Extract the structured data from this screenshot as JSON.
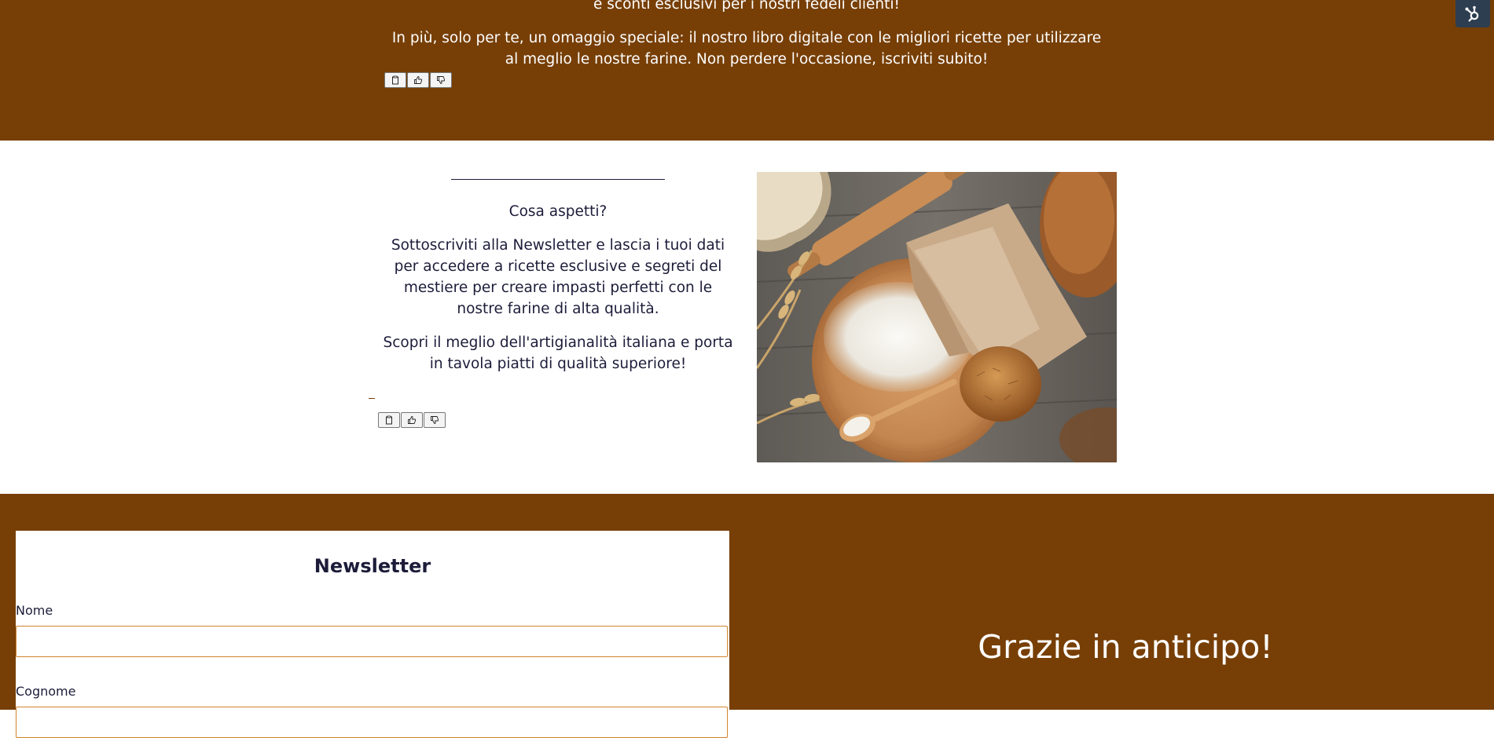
{
  "hero": {
    "line1": "e sconti esclusivi per i nostri fedeli clienti!",
    "line2": "In più, solo per te, un omaggio speciale: il nostro libro digitale con le migliori ricette per utilizzare al meglio le nostre farine. Non perdere l'occasione, iscriviti subito!"
  },
  "feedback_icons": [
    "clipboard-icon",
    "thumbs-up-icon",
    "thumbs-down-icon"
  ],
  "intro": {
    "heading": "Cosa aspetti?",
    "paragraph1": "Sottoscriviti alla Newsletter e lascia i tuoi dati per accedere a ricette esclusive e segreti del mestiere per creare impasti perfetti con le nostre farine di alta qualità.",
    "paragraph2": "Scopri il meglio dell'artigianalità italiana e porta in tavola piatti di qualità superiore!"
  },
  "form": {
    "title": "Newsletter",
    "name_label": "Nome",
    "name_value": "",
    "surname_label": "Cognome",
    "surname_value": ""
  },
  "thanks": "Grazie in anticipo!",
  "colors": {
    "brand_brown": "#773f06",
    "text_navy": "#1c1c3a",
    "input_border": "#d0842d",
    "hubspot_badge": "#2d3e50"
  }
}
